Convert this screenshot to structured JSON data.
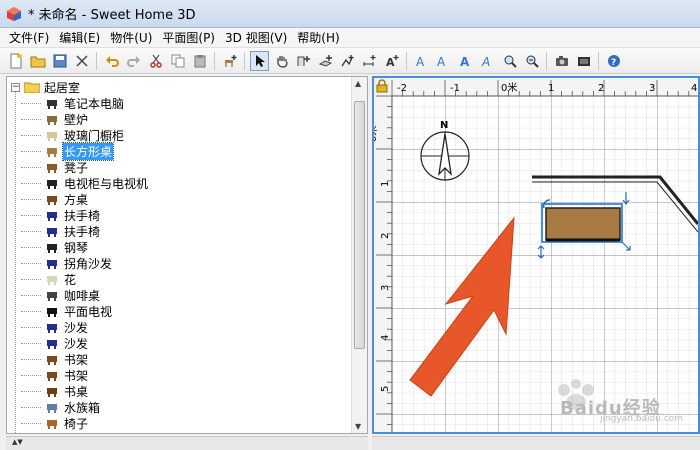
{
  "window": {
    "title": "* 未命名 - Sweet Home 3D",
    "accent": "#4a90d9"
  },
  "menu": [
    "文件(F)",
    "编辑(E)",
    "物件(U)",
    "平面图(P)",
    "3D 视图(V)",
    "帮助(H)"
  ],
  "toolbar": {
    "icons": [
      "new-file-icon",
      "open-icon",
      "save-icon",
      "cut-tools-icon",
      "undo-icon",
      "redo-icon",
      "cut-icon",
      "copy-icon",
      "paste-icon",
      "add-furniture-icon",
      "select-arrow-icon",
      "pan-hand-icon",
      "create-walls-icon",
      "create-rooms-icon",
      "create-polylines-icon",
      "create-dimensions-icon",
      "add-text-icon",
      "text-style-icon",
      "text-bold-icon",
      "text-italic-icon",
      "text-underline-icon",
      "zoom-in-icon",
      "zoom-out-icon",
      "create-photo-icon",
      "create-video-icon",
      "help-icon"
    ]
  },
  "catalog": {
    "root": "起居室",
    "items": [
      {
        "label": "笔记本电脑",
        "icon": "laptop-icon"
      },
      {
        "label": "壁炉",
        "icon": "fireplace-icon"
      },
      {
        "label": "玻璃门橱柜",
        "icon": "glass-cabinet-icon"
      },
      {
        "label": "长方形桌",
        "icon": "rectangular-table-icon",
        "selected": true
      },
      {
        "label": "凳子",
        "icon": "stool-icon"
      },
      {
        "label": "电视柜与电视机",
        "icon": "tv-cabinet-icon"
      },
      {
        "label": "方桌",
        "icon": "square-table-icon"
      },
      {
        "label": "扶手椅",
        "icon": "armchair-icon"
      },
      {
        "label": "扶手椅",
        "icon": "armchair-icon"
      },
      {
        "label": "钢琴",
        "icon": "piano-icon"
      },
      {
        "label": "拐角沙发",
        "icon": "corner-sofa-icon"
      },
      {
        "label": "花",
        "icon": "flower-icon"
      },
      {
        "label": "咖啡桌",
        "icon": "coffee-table-icon"
      },
      {
        "label": "平面电视",
        "icon": "flat-tv-icon"
      },
      {
        "label": "沙发",
        "icon": "sofa-icon"
      },
      {
        "label": "沙发",
        "icon": "sofa-icon"
      },
      {
        "label": "书架",
        "icon": "bookshelf-icon"
      },
      {
        "label": "书架",
        "icon": "bookshelf-icon"
      },
      {
        "label": "书桌",
        "icon": "desk-icon"
      },
      {
        "label": "水族箱",
        "icon": "aquarium-icon"
      },
      {
        "label": "椅子",
        "icon": "chair-icon"
      }
    ]
  },
  "plan": {
    "ruler_x": [
      "-2",
      "-1",
      "0米",
      "1",
      "2",
      "3",
      "4"
    ],
    "ruler_y": [
      "0米",
      "1",
      "2",
      "3",
      "4",
      "5"
    ],
    "compass_label": "N",
    "furniture_color": "#a87b45",
    "annotation_arrow_color": "#e8572a"
  },
  "watermark": {
    "text": "Baidu经验",
    "sub": "jingyan.baidu.com"
  }
}
